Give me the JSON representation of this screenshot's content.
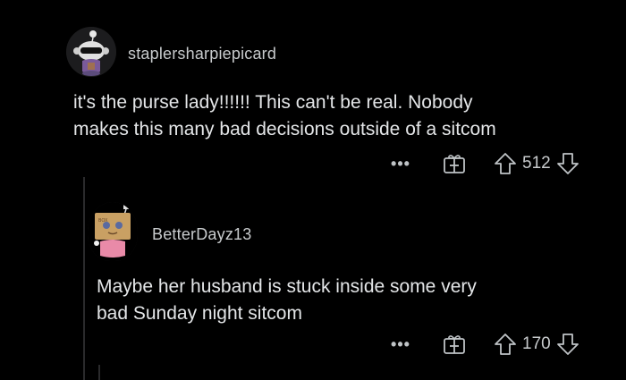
{
  "comments": [
    {
      "username": "staplersharpiepicard",
      "body_line1": "it's the purse lady!!!!!! This can't be real. Nobody",
      "body_line2": "makes this many bad decisions outside of a sitcom",
      "more_label": "•••",
      "score": "512",
      "avatar_icon": "snoo-sunglasses-avatar-icon"
    },
    {
      "username": "BetterDayz13",
      "body_line1": "Maybe her husband is stuck inside some very",
      "body_line2": "bad Sunday night sitcom",
      "more_label": "•••",
      "score": "170",
      "avatar_icon": "snoo-box-head-avatar-icon"
    }
  ],
  "colors": {
    "background": "#000000",
    "text": "#e4e6e8",
    "muted": "#bfc3c6",
    "thread_line": "#2a2a2c"
  }
}
